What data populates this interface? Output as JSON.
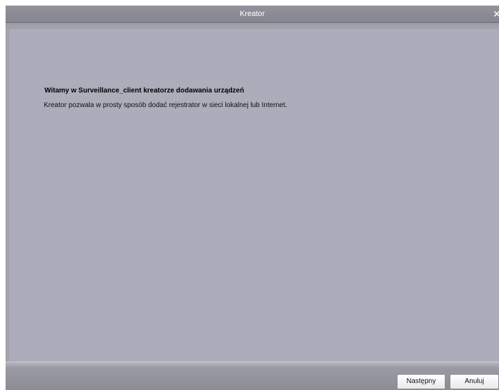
{
  "window": {
    "title": "Kreator",
    "close_symbol": "✕"
  },
  "wizard": {
    "heading": "Witamy w Surveillance_client kreatorze dodawania urządzeń",
    "description": "Kreator pozwala w prosty sposób dodać rejestrator w sieci lokalnej lub Internet."
  },
  "buttons": {
    "next_label": "Następny",
    "cancel_label": "Anuluj"
  },
  "icons": {
    "close": "close-icon"
  },
  "colors": {
    "window_bg": "#a3a3ad",
    "content_bg": "#acacba",
    "titlebar_bg": "#8a8a94",
    "button_bg": "#f2f2f4"
  }
}
